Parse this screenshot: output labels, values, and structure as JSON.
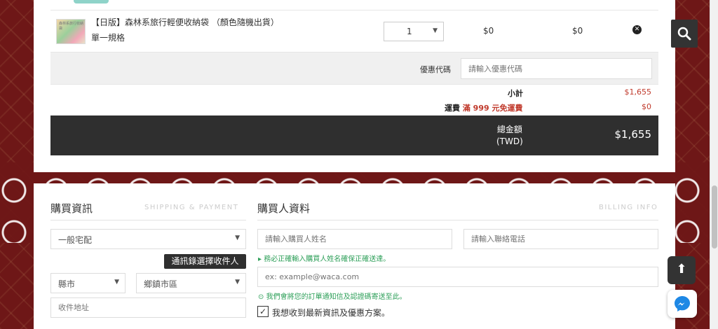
{
  "cart": {
    "product": {
      "name": "【日版】森林系旅行輕便收納袋 （顏色隨機出貨）",
      "spec": "單一規格",
      "thumb_caption": "森林系旅行收納袋",
      "quantity": "1",
      "price": "$0",
      "line_total": "$0"
    },
    "coupon": {
      "label": "優惠代碼",
      "placeholder": "請輸入優惠代碼"
    },
    "summary": {
      "subtotal_label": "小計",
      "subtotal_value": "$1,655",
      "shipping_label": "運費",
      "shipping_promo": "滿 999 元免運費",
      "shipping_value": "$0",
      "total_label_line1": "總金額",
      "total_label_line2": "(TWD)",
      "total_value": "$1,655"
    }
  },
  "shipping": {
    "title": "購買資訊",
    "subtitle": "SHIPPING & PAYMENT",
    "method_selected": "一般宅配",
    "contacts_button": "通訊錄選擇收件人",
    "city_selected": "縣市",
    "district_selected": "鄉鎮市區",
    "address_placeholder": "收件地址"
  },
  "billing": {
    "title": "購買人資料",
    "subtitle": "BILLING INFO",
    "name_placeholder": "請輸入購買人姓名",
    "phone_placeholder": "請輸入聯絡電話",
    "name_hint": "▸ 務必正確輸入購買人姓名確保正確送達。",
    "email_placeholder": "ex: example@waca.com",
    "email_hint": "我們會將您的訂單通知信及認證碼寄送至此。",
    "newsletter_label": "我想收到最新資訊及優惠方案。",
    "newsletter_checked": true
  },
  "icons": {
    "search": "search-icon",
    "remove": "remove-icon",
    "back_to_top": "arrow-up-icon",
    "messenger": "messenger-icon"
  },
  "colors": {
    "accent_red": "#c0392b",
    "dark": "#2f2f2f",
    "hint_green": "#2fa05a",
    "background_red": "#6e1717"
  }
}
